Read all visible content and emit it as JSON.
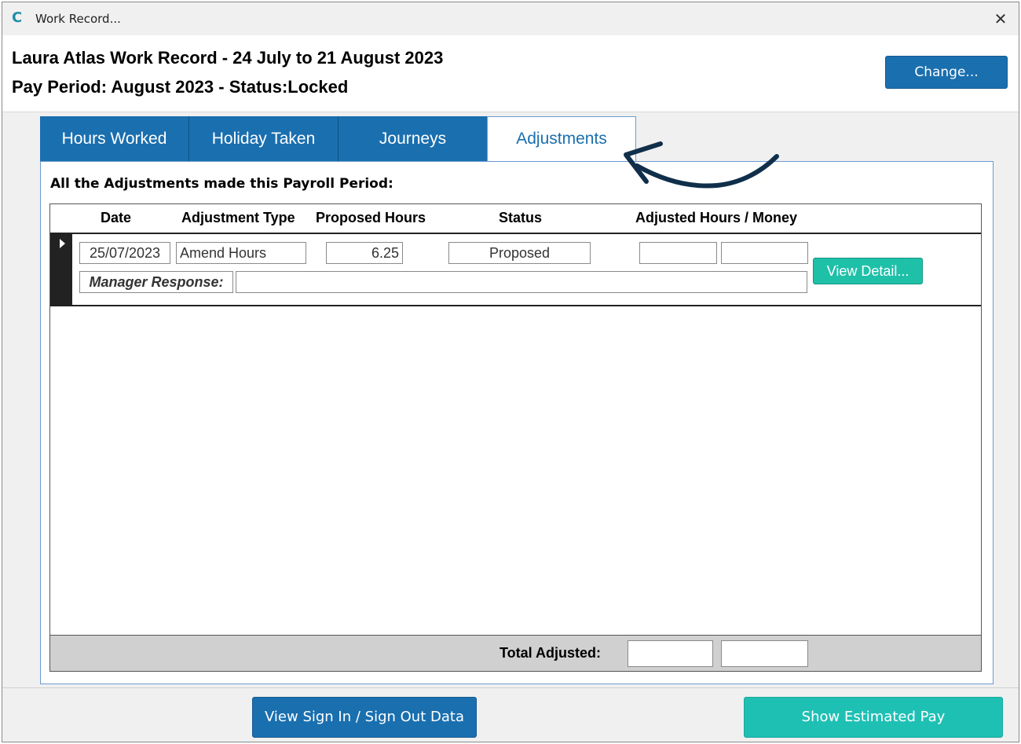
{
  "window": {
    "title": "Work Record...",
    "close_glyph": "✕",
    "app_icon": "C"
  },
  "header": {
    "line1": "Laura Atlas Work Record - 24 July to 21 August 2023",
    "line2": "Pay Period: August 2023 - Status:Locked",
    "change_label": "Change..."
  },
  "tabs": [
    {
      "label": "Hours Worked",
      "active": false
    },
    {
      "label": "Holiday Taken",
      "active": false
    },
    {
      "label": "Journeys",
      "active": false
    },
    {
      "label": "Adjustments",
      "active": true
    }
  ],
  "panel": {
    "caption": "All the Adjustments made this Payroll Period:"
  },
  "grid": {
    "columns": [
      "Date",
      "Adjustment Type",
      "Proposed Hours",
      "Status",
      "Adjusted Hours / Money"
    ],
    "rows": [
      {
        "date": "25/07/2023",
        "type": "Amend Hours",
        "proposed_hours": "6.25",
        "status": "Proposed",
        "adjusted_hours": "",
        "adjusted_money": "",
        "manager_response_label": "Manager Response:",
        "manager_response": "",
        "view_detail_label": "View Detail..."
      }
    ],
    "total_label": "Total Adjusted:",
    "total_hours": "",
    "total_money": ""
  },
  "footer": {
    "signin_label": "View Sign In / Sign Out Data",
    "pay_label": "Show Estimated Pay"
  },
  "colors": {
    "primary_blue": "#1a6faf",
    "teal": "#1fc0b4",
    "arrow": "#0f2f4a"
  }
}
